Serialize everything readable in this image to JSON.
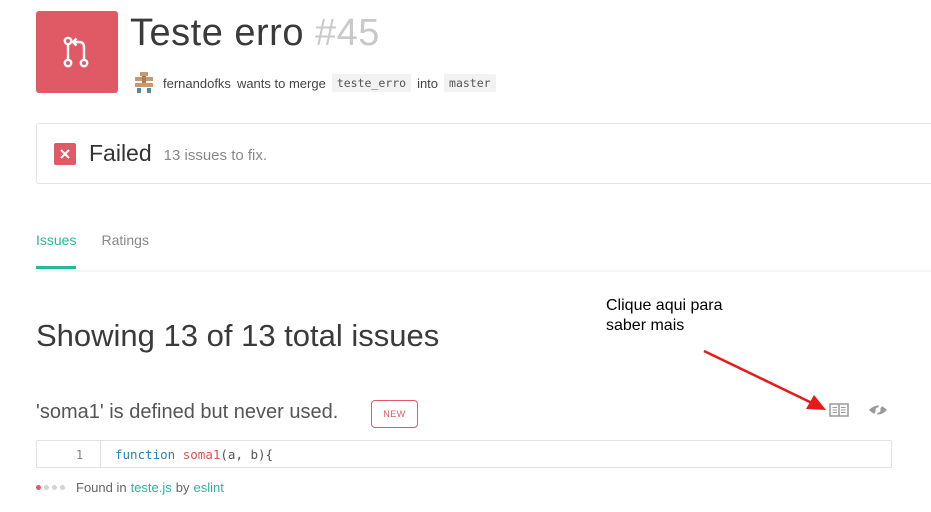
{
  "pr": {
    "title": "Teste erro",
    "number": "#45",
    "author": "fernandofks",
    "merge_text": "wants to merge",
    "source_branch": "teste_erro",
    "into_text": "into",
    "target_branch": "master"
  },
  "status": {
    "label": "Failed",
    "detail": "13 issues to fix."
  },
  "tabs": [
    {
      "label": "Issues",
      "active": true
    },
    {
      "label": "Ratings",
      "active": false
    }
  ],
  "summary": "Showing 13 of 13 total issues",
  "annotation": {
    "line1": "Clique aqui para",
    "line2": "saber mais",
    "color": "#e8191b"
  },
  "issue": {
    "message": "'soma1' is defined but never used.",
    "badge": "NEW",
    "code": {
      "line_number": "1",
      "keyword": "function",
      "name": "soma1",
      "rest": "(a, b){"
    },
    "found": {
      "prefix": "Found in",
      "file": "teste.js",
      "by": "by",
      "tool": "eslint"
    }
  },
  "colors": {
    "accent": "#2bb59a",
    "danger": "#e05a66"
  }
}
